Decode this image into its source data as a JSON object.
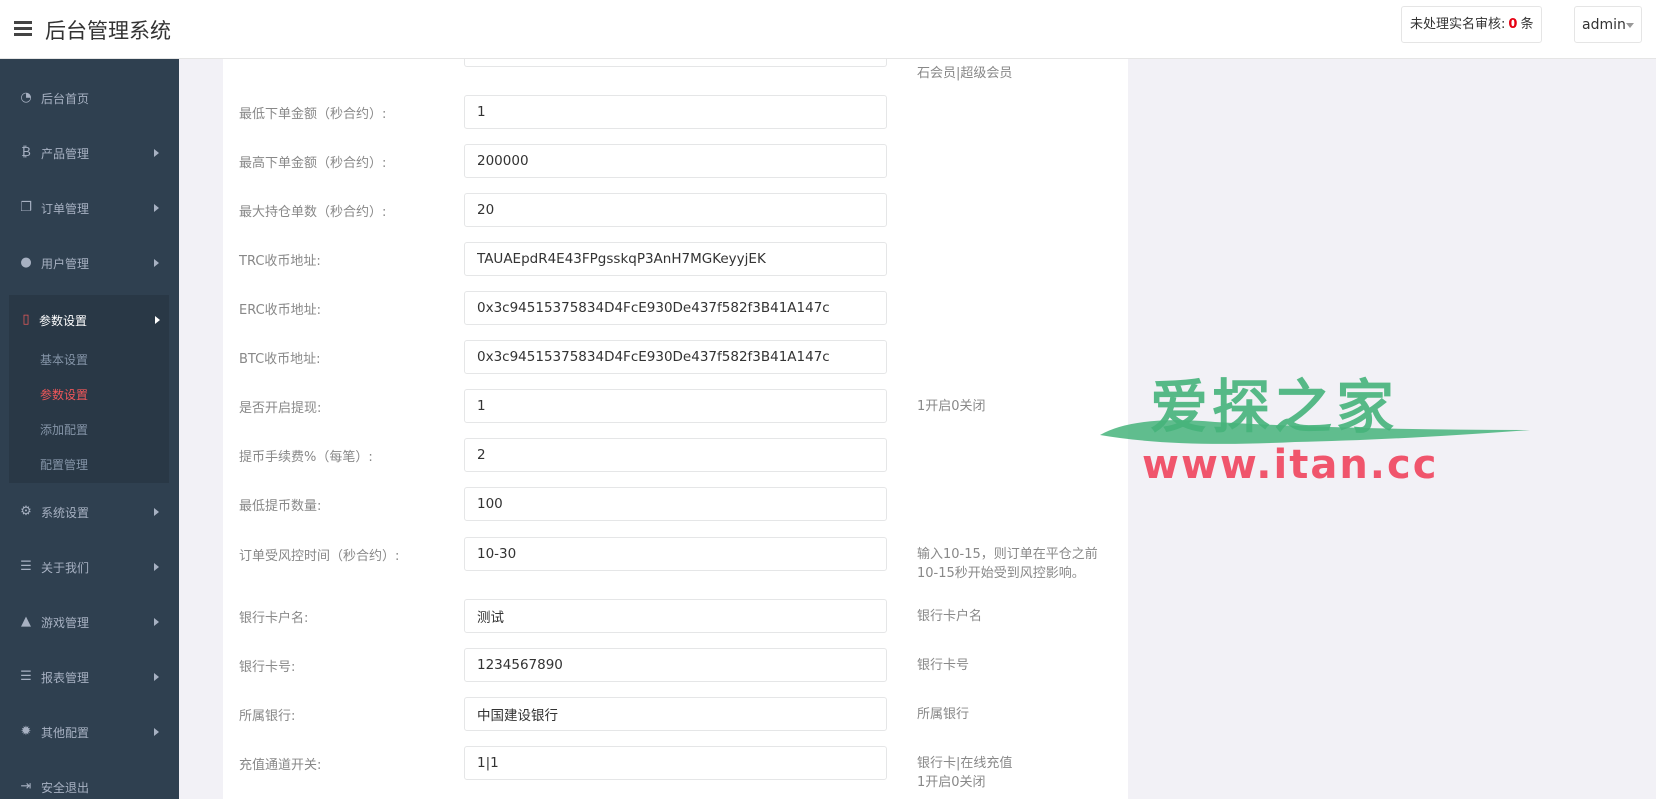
{
  "header": {
    "title": "后台管理系统",
    "notice_prefix": "未处理实名审核:",
    "notice_count": "0",
    "notice_suffix": "条",
    "user": "admin"
  },
  "sidebar": {
    "items": [
      {
        "label": "后台首页",
        "icon": "dashboard-icon"
      },
      {
        "label": "产品管理",
        "icon": "bitcoin-icon"
      },
      {
        "label": "订单管理",
        "icon": "copy-icon"
      },
      {
        "label": "用户管理",
        "icon": "user-icon"
      },
      {
        "label": "参数设置",
        "icon": "file-icon"
      },
      {
        "label": "系统设置",
        "icon": "gears-icon"
      },
      {
        "label": "关于我们",
        "icon": "list-icon"
      },
      {
        "label": "游戏管理",
        "icon": "bell-icon"
      },
      {
        "label": "报表管理",
        "icon": "list-icon"
      },
      {
        "label": "其他配置",
        "icon": "gear-icon"
      },
      {
        "label": "安全退出",
        "icon": "sign-out-icon"
      }
    ],
    "sub_items": [
      "基本设置",
      "参数设置",
      "添加配置",
      "配置管理"
    ],
    "active_sub": "参数设置"
  },
  "form": {
    "top_hint": "石会员|超级会员",
    "fields": [
      {
        "label": "最低下单金额（秒合约）:",
        "value": "1",
        "hint": ""
      },
      {
        "label": "最高下单金额（秒合约）:",
        "value": "200000",
        "hint": ""
      },
      {
        "label": "最大持仓单数（秒合约）:",
        "value": "20",
        "hint": ""
      },
      {
        "label": "TRC收币地址:",
        "value": "TAUAEpdR4E43FPgsskqP3AnH7MGKeyyjEK",
        "hint": ""
      },
      {
        "label": "ERC收币地址:",
        "value": "0x3c94515375834D4FcE930De437f582f3B41A147c",
        "hint": ""
      },
      {
        "label": "BTC收币地址:",
        "value": "0x3c94515375834D4FcE930De437f582f3B41A147c",
        "hint": ""
      },
      {
        "label": "是否开启提现:",
        "value": "1",
        "hint": "1开启0关闭"
      },
      {
        "label": "提币手续费%（每笔）:",
        "value": "2",
        "hint": ""
      },
      {
        "label": "最低提币数量:",
        "value": "100",
        "hint": ""
      },
      {
        "label": "订单受风控时间（秒合约）:",
        "value": "10-30",
        "hint": "输入10-15，则订单在平仓之前",
        "hint2": "10-15秒开始受到风控影响。"
      },
      {
        "label": "银行卡户名:",
        "value": "测试",
        "hint": "银行卡户名"
      },
      {
        "label": "银行卡号:",
        "value": "1234567890",
        "hint": "银行卡号"
      },
      {
        "label": "所属银行:",
        "value": "中国建设银行",
        "hint": "所属银行"
      },
      {
        "label": "充值通道开关:",
        "value": "1|1",
        "hint": "银行卡|在线充值",
        "hint2": "1开启0关闭"
      }
    ]
  },
  "watermark": {
    "cn": "爱探之家",
    "url": "www.itan.cc"
  }
}
